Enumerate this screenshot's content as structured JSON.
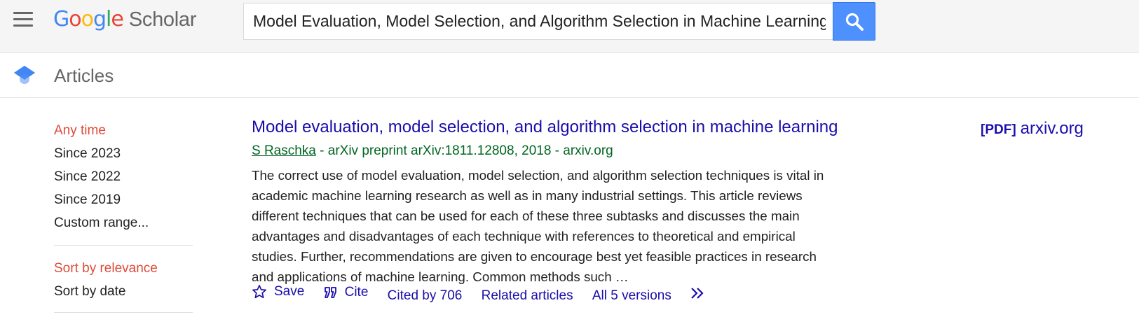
{
  "header": {
    "logo_brand": [
      "G",
      "o",
      "o",
      "g",
      "l",
      "e"
    ],
    "logo_colors": [
      "#4285f4",
      "#ea4335",
      "#fbbc05",
      "#4285f4",
      "#34a853",
      "#ea4335"
    ],
    "logo_product": "Scholar",
    "search_value": "Model Evaluation, Model Selection, and Algorithm Selection in Machine Learning",
    "menu_icon": "hamburger-menu-icon",
    "search_icon": "magnifier-icon",
    "accent_color": "#4d90fe"
  },
  "section": {
    "label": "Articles",
    "icon": "graduation-cap-icon"
  },
  "sidebar": {
    "time_filters": [
      {
        "label": "Any time",
        "active": true
      },
      {
        "label": "Since 2023",
        "active": false
      },
      {
        "label": "Since 2022",
        "active": false
      },
      {
        "label": "Since 2019",
        "active": false
      },
      {
        "label": "Custom range...",
        "active": false
      }
    ],
    "sort_options": [
      {
        "label": "Sort by relevance",
        "active": true
      },
      {
        "label": "Sort by date",
        "active": false
      }
    ],
    "active_color": "#dd4b39"
  },
  "result": {
    "title": "Model evaluation, model selection, and algorithm selection in machine learning",
    "author": "S Raschka",
    "meta_rest": " - arXiv preprint arXiv:1811.12808, 2018 - arxiv.org",
    "snippet": "The correct use of model evaluation, model selection, and algorithm selection techniques is vital in academic machine learning research as well as in many industrial settings. This article reviews different techniques that can be used for each of these three subtasks and discusses the main advantages and disadvantages of each technique with references to theoretical and empirical studies. Further, recommendations are given to encourage best yet feasible practices in research and applications of machine learning. Common methods such …",
    "actions": {
      "save": "Save",
      "cite": "Cite",
      "cited_by": "Cited by 706",
      "related": "Related articles",
      "versions": "All 5 versions"
    },
    "pdf_tag": "[PDF]",
    "pdf_source": "arxiv.org",
    "link_color": "#1a0dab",
    "meta_color": "#006621"
  }
}
